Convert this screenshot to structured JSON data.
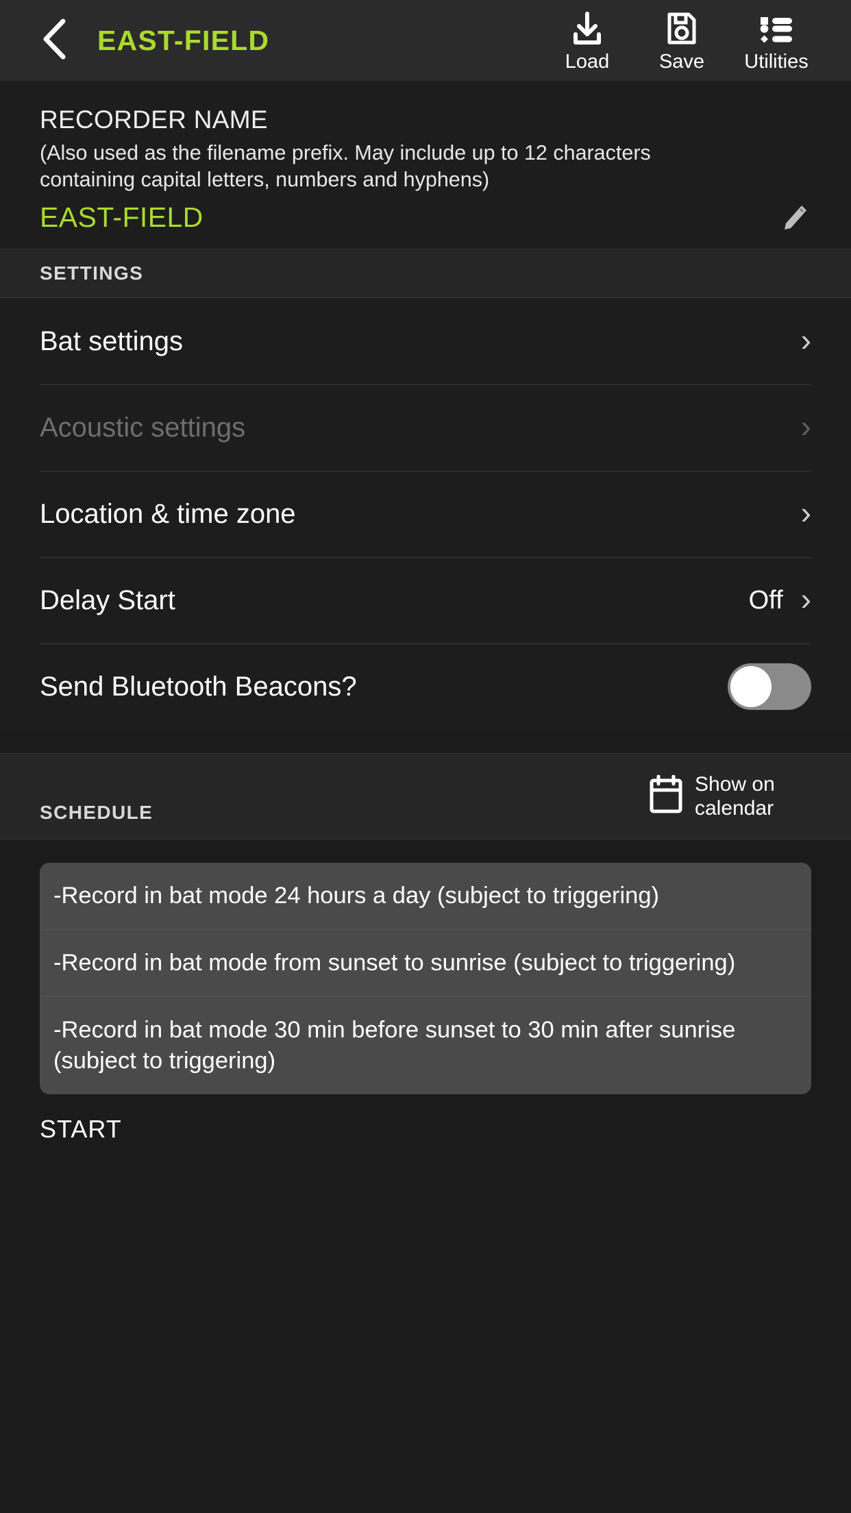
{
  "header": {
    "back_icon": "chevron-left-icon",
    "title": "EAST-FIELD",
    "actions": [
      {
        "label": "Load",
        "icon": "download-icon"
      },
      {
        "label": "Save",
        "icon": "floppy-disk-icon"
      },
      {
        "label": "Utilities",
        "icon": "list-bullets-icon"
      }
    ]
  },
  "recorder": {
    "title": "RECORDER NAME",
    "hint": "(Also used as the filename prefix. May include up to 12 characters containing capital letters, numbers and hyphens)",
    "value": "EAST-FIELD",
    "edit_icon": "pencil-icon"
  },
  "settings": {
    "section_label": "SETTINGS",
    "rows": [
      {
        "label": "Bat settings",
        "value": "",
        "type": "chevron",
        "disabled": false
      },
      {
        "label": "Acoustic settings",
        "value": "",
        "type": "chevron",
        "disabled": true
      },
      {
        "label": "Location & time zone",
        "value": "",
        "type": "chevron",
        "disabled": false
      },
      {
        "label": "Delay Start",
        "value": "Off",
        "type": "chevron",
        "disabled": false
      },
      {
        "label": "Send Bluetooth Beacons?",
        "value": "",
        "type": "toggle",
        "toggle_on": false,
        "disabled": false
      }
    ]
  },
  "schedule": {
    "section_label": "SCHEDULE",
    "calendar_link_label": "Show on calendar",
    "calendar_icon": "calendar-icon",
    "items": [
      "-Record in bat mode 24 hours a day (subject to triggering)",
      "-Record in bat mode from sunset to sunrise (subject to triggering)",
      "-Record in bat mode 30 min before sunset to 30 min after sunrise (subject to triggering)"
    ],
    "start_label": "START"
  },
  "colors": {
    "accent_green": "#aada2e",
    "background": "#1b1b1b",
    "surface": "#1d1d1d",
    "section_bar": "#262626",
    "card": "#4a4a4a",
    "disabled_text": "#6e6e6e"
  }
}
